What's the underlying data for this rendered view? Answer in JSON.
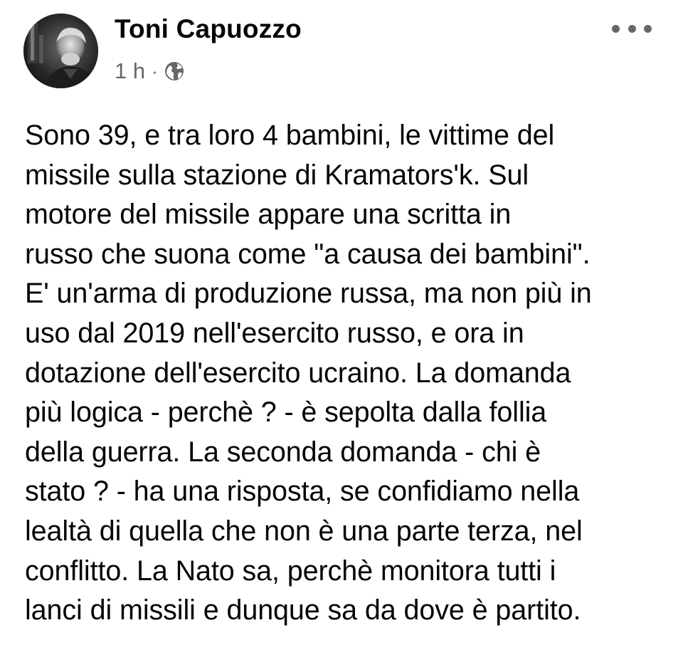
{
  "post": {
    "author": {
      "name": "Toni Capuozzo",
      "avatar": "profile-photo"
    },
    "meta": {
      "timestamp": "1 h",
      "separator": "·",
      "audience_icon": "globe-icon"
    },
    "more_icon": "more-options-icon",
    "text": "Sono 39, e tra loro 4 bambini, le vittime del\nmissile sulla stazione di Kramators'k.  Sul\nmotore del missile appare una scritta in\nrusso che suona come \"a causa dei bambini\".\nE' un'arma di produzione russa, ma non più in\nuso dal 2019 nell'esercito russo, e ora in\ndotazione dell'esercito ucraino. La domanda\npiù logica - perchè ? - è sepolta dalla follia\ndella guerra. La seconda domanda - chi è\nstato ? - ha una risposta, se confidiamo nella\nlealtà di quella che non è una parte terza, nel\nconflitto. La Nato sa, perchè monitora tutti i\nlanci di missili e dunque sa da dove è partito."
  }
}
